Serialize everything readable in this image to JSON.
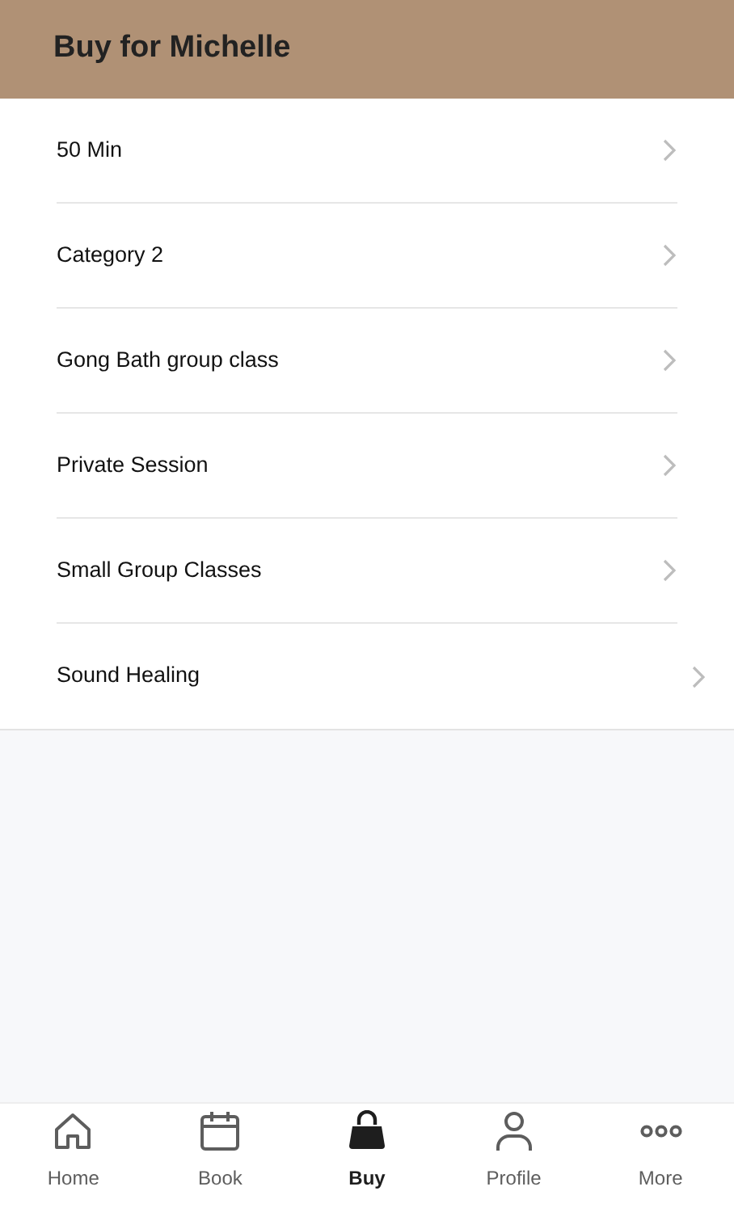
{
  "header": {
    "title": "Buy for Michelle"
  },
  "items": [
    {
      "label": "50 Min"
    },
    {
      "label": "Category 2"
    },
    {
      "label": "Gong Bath group class"
    },
    {
      "label": "Private Session"
    },
    {
      "label": "Small Group Classes"
    },
    {
      "label": "Sound Healing"
    }
  ],
  "tab_bar": [
    {
      "label": "Home",
      "selected": false
    },
    {
      "label": "Book",
      "selected": false
    },
    {
      "label": "Buy",
      "selected": true
    },
    {
      "label": "Profile",
      "selected": false
    },
    {
      "label": "More",
      "selected": false
    }
  ]
}
